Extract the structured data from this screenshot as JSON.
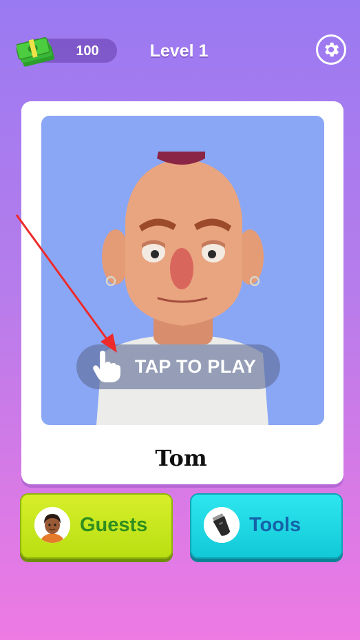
{
  "hud": {
    "money": "100",
    "level_title": "Level 1"
  },
  "character": {
    "name": "Tom"
  },
  "prompt": {
    "tap_to_play": "TAP TO PLAY"
  },
  "buttons": {
    "guests_label": "Guests",
    "tools_label": "Tools"
  },
  "icons": {
    "money": "cash-stack-icon",
    "settings": "gear-icon",
    "tap": "pointing-hand-icon",
    "guests": "guest-avatar-icon",
    "tools": "hair-clipper-icon"
  },
  "colors": {
    "background_top": "#9a7af2",
    "background_bottom": "#ee7ae4",
    "portrait_bg": "#8aa7f5",
    "guests_button": "#c8e61c",
    "tools_button": "#1ed8e4",
    "arrow": "#ee2a2a"
  }
}
